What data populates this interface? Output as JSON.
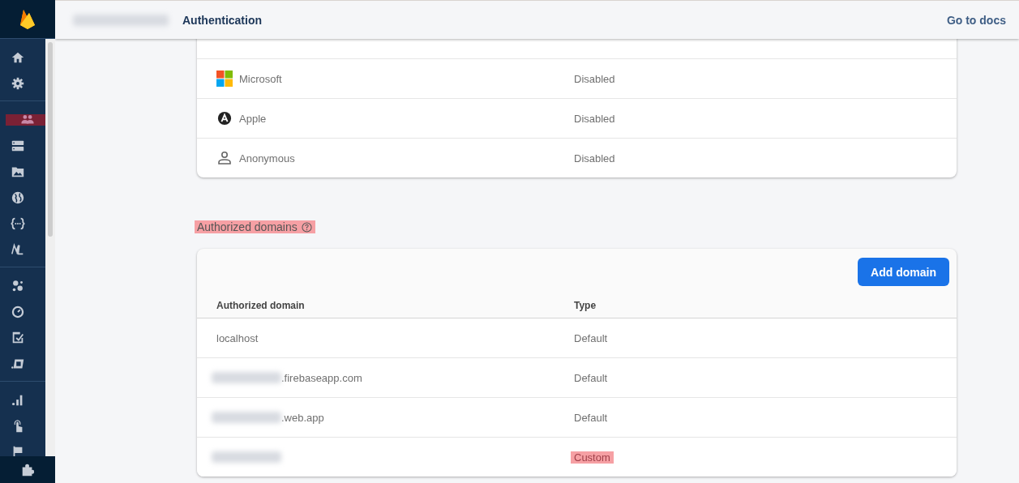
{
  "header": {
    "project_redacted": true,
    "title": "Authentication",
    "docs_link": "Go to docs"
  },
  "sidebar": {
    "groups": [
      {
        "items": [
          {
            "selected": false
          },
          {
            "selected": false
          }
        ]
      },
      {
        "items": [
          {
            "selected": true
          },
          {
            "selected": false
          },
          {
            "selected": false
          },
          {
            "selected": false
          },
          {
            "selected": false
          },
          {
            "selected": false
          }
        ]
      },
      {
        "items": [
          {
            "selected": false
          },
          {
            "selected": false
          },
          {
            "selected": false
          },
          {
            "selected": false
          }
        ]
      },
      {
        "items": [
          {
            "selected": false
          },
          {
            "selected": false
          },
          {
            "selected": false
          }
        ]
      }
    ],
    "footer_item": {
      "selected": false
    }
  },
  "providers": [
    {
      "kind": "microsoft",
      "name": "Microsoft",
      "status": "Disabled"
    },
    {
      "kind": "apple",
      "name": "Apple",
      "status": "Disabled"
    },
    {
      "kind": "anonymous",
      "name": "Anonymous",
      "status": "Disabled"
    }
  ],
  "domains_section": {
    "title": "Authorized domains",
    "highlighted": true,
    "add_button": "Add domain",
    "columns": [
      "Authorized domain",
      "Type"
    ],
    "rows": [
      {
        "redacted": false,
        "domain": "localhost",
        "type": "Default",
        "highlighted": false
      },
      {
        "redacted": true,
        "domain": ".firebaseapp.com",
        "type": "Default",
        "highlighted": false
      },
      {
        "redacted": true,
        "domain": ".web.app",
        "type": "Default",
        "highlighted": false
      },
      {
        "redacted": true,
        "type": "Custom",
        "highlighted": true
      }
    ]
  }
}
